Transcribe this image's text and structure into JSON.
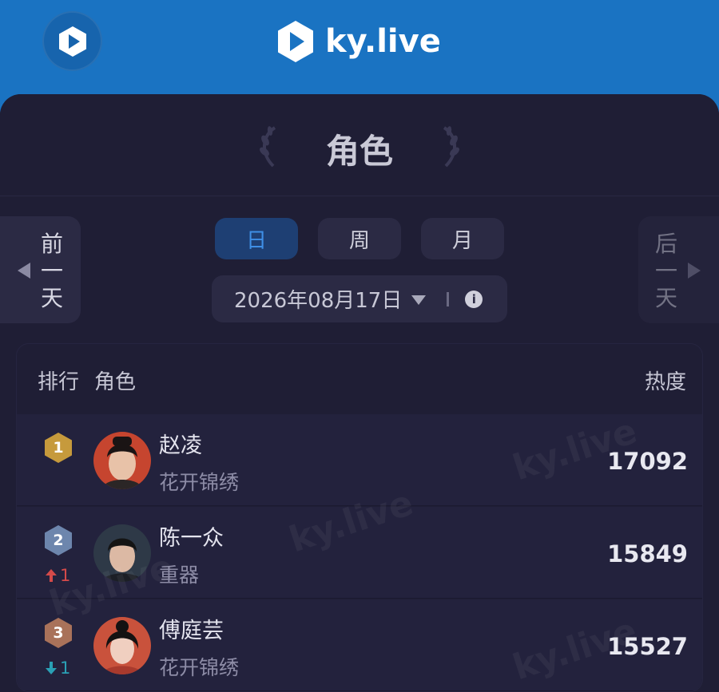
{
  "header": {
    "brand": "ky.live",
    "colors": {
      "bar": "#1a73c2",
      "panel": "#1f1e35"
    }
  },
  "page": {
    "title": "角色"
  },
  "nav": {
    "prev_label": "前一天",
    "next_label": "后一天"
  },
  "tabs": [
    {
      "label": "日",
      "active": true
    },
    {
      "label": "周",
      "active": false
    },
    {
      "label": "月",
      "active": false
    }
  ],
  "date": {
    "value": "2026年08月17日"
  },
  "table": {
    "col_rank": "排行",
    "col_role": "角色",
    "col_heat": "热度",
    "rows": [
      {
        "rank": "1",
        "name": "赵凌",
        "show": "花开锦绣",
        "heat": "17092",
        "badge_color": "#c69a3c",
        "change": "",
        "change_dir": ""
      },
      {
        "rank": "2",
        "name": "陈一众",
        "show": "重器",
        "heat": "15849",
        "badge_color": "#6d86ad",
        "change": "1",
        "change_dir": "up"
      },
      {
        "rank": "3",
        "name": "傅庭芸",
        "show": "花开锦绣",
        "heat": "15527",
        "badge_color": "#a9725a",
        "change": "1",
        "change_dir": "down"
      }
    ]
  },
  "watermark_text": "ky.live"
}
